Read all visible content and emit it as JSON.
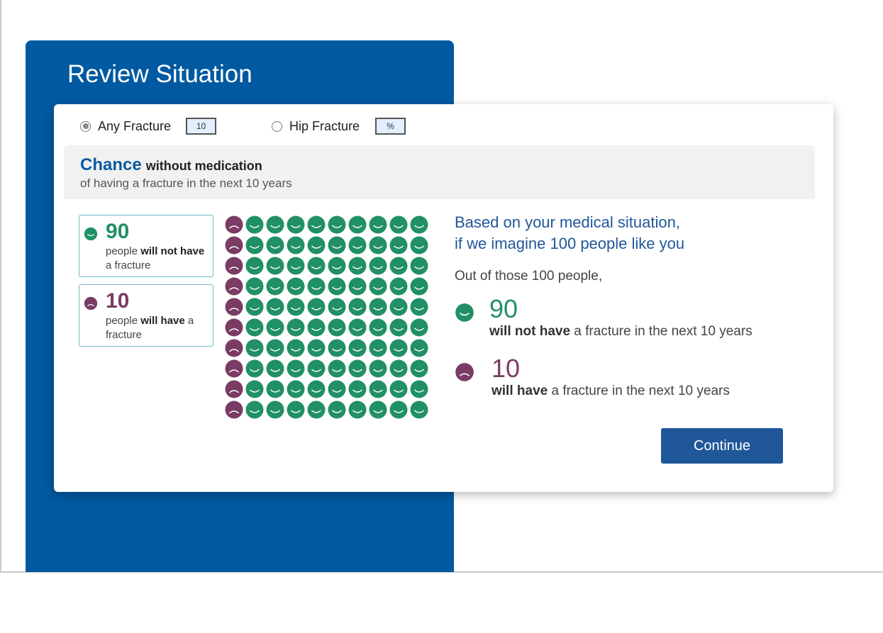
{
  "page": {
    "title": "Review Situation"
  },
  "fracture_options": [
    {
      "label": "Any Fracture",
      "selected": true,
      "value": "10"
    },
    {
      "label": "Hip Fracture",
      "selected": false,
      "value": "%"
    }
  ],
  "chance_header": {
    "title": "Chance",
    "title_suffix": "without medication",
    "subtitle": "of having a fracture in the next 10 years"
  },
  "legend": {
    "no_fracture": {
      "count": "90",
      "text_pre": "people ",
      "text_bold": "will not have",
      "text_post": " a fracture"
    },
    "fracture": {
      "count": "10",
      "text_pre": "people ",
      "text_bold": "will have",
      "text_post": " a fracture"
    }
  },
  "icon_grid": {
    "rows": 10,
    "cols": 10,
    "fracture_per_row": 1,
    "total": 100,
    "fracture_count": 10,
    "no_fracture_count": 90
  },
  "explanation": {
    "heading_line1": "Based on your medical situation,",
    "heading_line2": "if we imagine 100 people like you",
    "intro": "Out of those 100 people,",
    "no_fracture": {
      "count": "90",
      "bold": "will not have",
      "rest": " a fracture in the next 10 years"
    },
    "fracture": {
      "count": "10",
      "bold": "will have",
      "rest": " a fracture in the next 10 years"
    }
  },
  "continue_button": {
    "label": "Continue"
  },
  "colors": {
    "panel_blue": "#0059a1",
    "green": "#219065",
    "purple": "#7a3b64",
    "button_blue": "#1f5799"
  },
  "icons": {
    "happy": "happy-face-icon",
    "sad": "sad-face-icon"
  }
}
